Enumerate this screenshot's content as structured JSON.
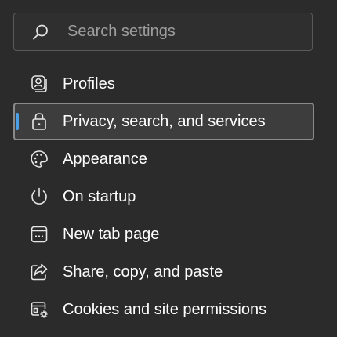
{
  "search": {
    "placeholder": "Search settings",
    "value": ""
  },
  "nav": {
    "items": [
      {
        "label": "Profiles",
        "icon": "profile-icon",
        "selected": false
      },
      {
        "label": "Privacy, search, and services",
        "icon": "lock-icon",
        "selected": true
      },
      {
        "label": "Appearance",
        "icon": "palette-icon",
        "selected": false
      },
      {
        "label": "On startup",
        "icon": "power-icon",
        "selected": false
      },
      {
        "label": "New tab page",
        "icon": "new-tab-icon",
        "selected": false
      },
      {
        "label": "Share, copy, and paste",
        "icon": "share-icon",
        "selected": false
      },
      {
        "label": "Cookies and site permissions",
        "icon": "cookies-permissions-icon",
        "selected": false
      }
    ]
  },
  "colors": {
    "background": "#2b2b2b",
    "accent": "#4aa0e8",
    "selected_background": "#3d3d3d",
    "selected_border": "#8a8a8a",
    "placeholder": "#9e9e9e"
  }
}
